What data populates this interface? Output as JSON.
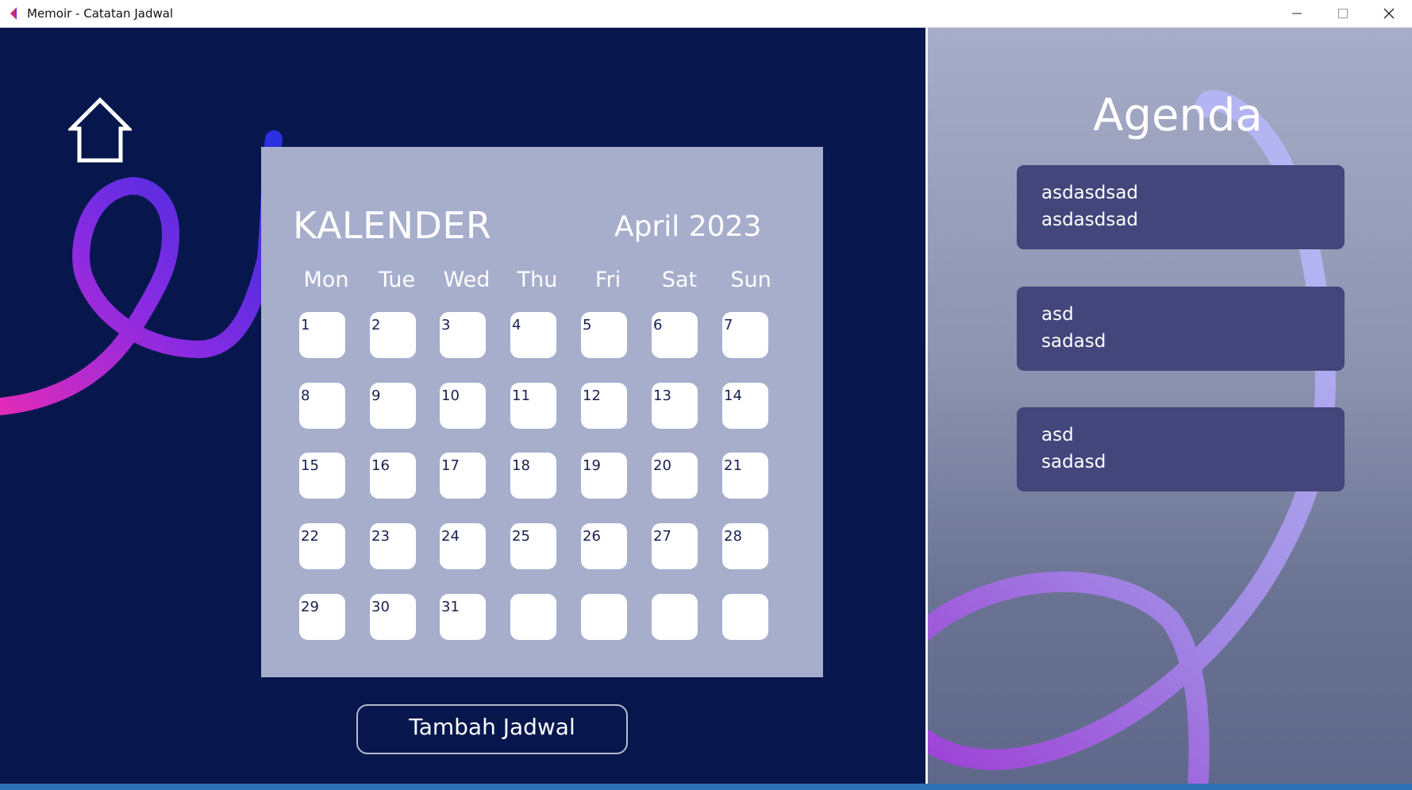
{
  "window": {
    "title": "Memoir - Catatan Jadwal",
    "controls": [
      "minimize-icon",
      "maximize-icon",
      "close-icon"
    ]
  },
  "calendar": {
    "title": "KALENDER",
    "month_label": "April 2023",
    "weekdays": [
      "Mon",
      "Tue",
      "Wed",
      "Thu",
      "Fri",
      "Sat",
      "Sun"
    ],
    "days": [
      "1",
      "2",
      "3",
      "4",
      "5",
      "6",
      "7",
      "8",
      "9",
      "10",
      "11",
      "12",
      "13",
      "14",
      "15",
      "16",
      "17",
      "18",
      "19",
      "20",
      "21",
      "22",
      "23",
      "24",
      "25",
      "26",
      "27",
      "28",
      "29",
      "30",
      "31",
      "",
      "",
      "",
      ""
    ]
  },
  "add_button": {
    "label": "Tambah Jadwal"
  },
  "agenda": {
    "title": "Agenda",
    "items": [
      {
        "line1": "asdasdsad",
        "line2": "asdasdsad"
      },
      {
        "line1": "asd",
        "line2": "sadasd"
      },
      {
        "line1": "asd",
        "line2": "sadasd"
      }
    ]
  },
  "colors": {
    "left_bg": "#07174d",
    "calendar_bg": "#a7aecc",
    "agenda_card": "#43467b",
    "accent_pink": "#e02bb8",
    "accent_blue": "#2a2fe0",
    "accent_lavender": "#b0b0f2"
  },
  "icons": {
    "home": "home-icon",
    "app": "app-logo-icon"
  }
}
